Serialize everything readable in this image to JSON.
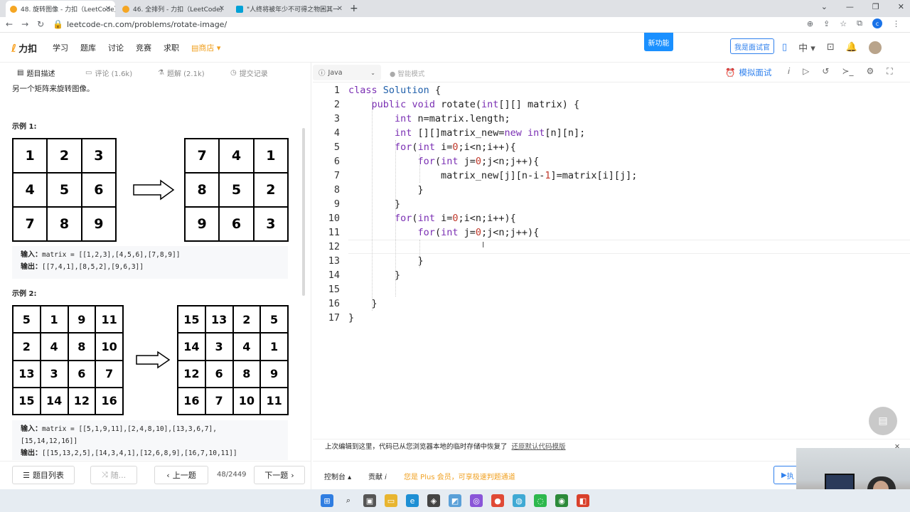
{
  "browser": {
    "tabs": [
      {
        "title": "48. 旋转图像 - 力扣（LeetCode）"
      },
      {
        "title": "46. 全排列 - 力扣（LeetCode）"
      },
      {
        "title": "\"人终将被年少不可得之物困其一"
      }
    ],
    "url": "leetcode-cn.com/problems/rotate-image/",
    "profile_initial": "c"
  },
  "header": {
    "logo": "力扣",
    "nav": [
      "学习",
      "题库",
      "讨论",
      "竞赛",
      "求职",
      "商店"
    ],
    "new_feature": "新功能",
    "interviewer": "我是面试官",
    "lang": "中"
  },
  "left_tabs": {
    "description": "题目描述",
    "comments": "评论 (1.6k)",
    "solutions": "题解 (2.1k)",
    "submissions": "提交记录"
  },
  "problem": {
    "desc_line": "另一个矩阵来旋转图像。",
    "example1": {
      "title": "示例 1:",
      "input_grid": [
        [
          1,
          2,
          3
        ],
        [
          4,
          5,
          6
        ],
        [
          7,
          8,
          9
        ]
      ],
      "output_grid": [
        [
          7,
          4,
          1
        ],
        [
          8,
          5,
          2
        ],
        [
          9,
          6,
          3
        ]
      ],
      "input_label": "输入：",
      "input_text": "matrix = [[1,2,3],[4,5,6],[7,8,9]]",
      "output_label": "输出：",
      "output_text": "[[7,4,1],[8,5,2],[9,6,3]]"
    },
    "example2": {
      "title": "示例 2:",
      "input_grid": [
        [
          5,
          1,
          9,
          11
        ],
        [
          2,
          4,
          8,
          10
        ],
        [
          13,
          3,
          6,
          7
        ],
        [
          15,
          14,
          12,
          16
        ]
      ],
      "output_grid": [
        [
          15,
          13,
          2,
          5
        ],
        [
          14,
          3,
          4,
          1
        ],
        [
          12,
          6,
          8,
          9
        ],
        [
          16,
          7,
          10,
          11
        ]
      ],
      "input_label": "输入：",
      "input_text1": "matrix = [[5,1,9,11],[2,4,8,10],[13,3,6,7],",
      "input_text2": "[15,14,12,16]]",
      "output_label": "输出：",
      "output_text": "[[15,13,2,5],[14,3,4,1],[12,6,8,9],[16,7,10,11]]"
    }
  },
  "left_bar": {
    "list": "题目列表",
    "random": "随...",
    "prev": "上一题",
    "page": "48/2449",
    "next": "下一题"
  },
  "editor": {
    "language": "Java",
    "smart_mode": "智能模式",
    "mock_interview": "模拟面试",
    "lines": [
      "class Solution {",
      "    public void rotate(int[][] matrix) {",
      "        int n=matrix.length;",
      "        int [][]matrix_new=new int[n][n];",
      "        for(int i=0;i<n;i++){",
      "            for(int j=0;j<n;j++){",
      "                matrix_new[j][n-i-1]=matrix[i][j];",
      "            }",
      "        }",
      "        for(int i=0;i<n;i++){",
      "            for(int j=0;j<n;j++){",
      "",
      "            }",
      "        }",
      "",
      "    }",
      "}"
    ],
    "restore_msg": "上次编辑到这里，代码已从您浏览器本地的临时存储中恢复了",
    "restore_link": "还原默认代码模版"
  },
  "editor_bar": {
    "console": "控制台",
    "contribute": "贡献",
    "plus_msg": "您是 Plus 会员，可享极速判题通道",
    "run": "执"
  },
  "colors": {
    "accent": "#2f80ed",
    "orange": "#f0a020",
    "keyword": "#7a2fb3"
  }
}
